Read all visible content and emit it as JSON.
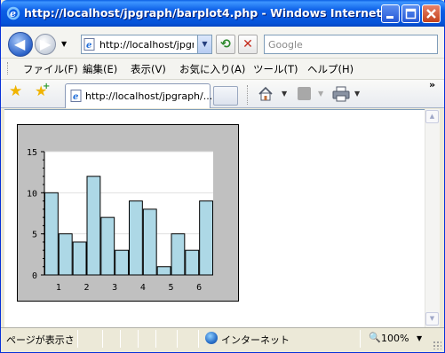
{
  "window": {
    "title": "http://localhost/jpgraph/barplot4.php - Windows Internet..."
  },
  "address_bar": {
    "url": "http://localhost/jpgr",
    "search_placeholder": "Google"
  },
  "menu": {
    "items": [
      "ファイル(F)",
      "編集(E)",
      "表示(V)",
      "お気に入り(A)",
      "ツール(T)",
      "ヘルプ(H)"
    ]
  },
  "tab": {
    "label": "http://localhost/jpgraph/..."
  },
  "status": {
    "text": "ページが表示さ",
    "zone": "インターネット",
    "zoom": "100%"
  },
  "colors": {
    "bar_fill": "#add8e6",
    "plot_background": "#ffffff",
    "chart_margin": "#c0c0c0",
    "titlebar": "#0b5ee6"
  },
  "chart_data": {
    "type": "bar",
    "values": [
      10,
      5,
      4,
      12,
      7,
      3,
      9,
      8,
      1,
      5,
      3,
      9
    ],
    "x_tick_labels": [
      "1",
      "2",
      "3",
      "4",
      "5",
      "6"
    ],
    "y_tick_labels": [
      "0",
      "5",
      "10",
      "15"
    ],
    "ylim": [
      0,
      15
    ],
    "grid": true,
    "title": "",
    "xlabel": "",
    "ylabel": ""
  }
}
